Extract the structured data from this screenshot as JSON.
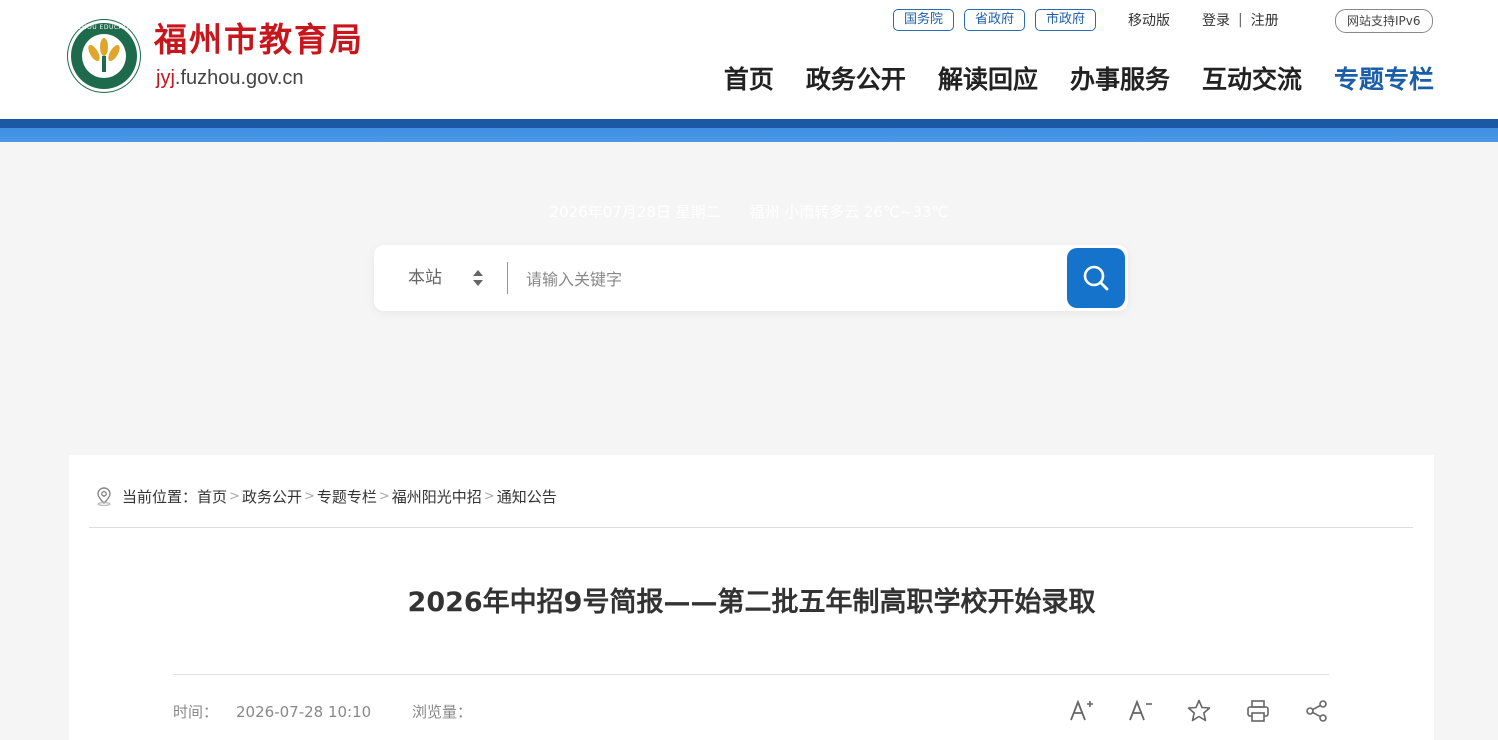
{
  "header": {
    "site_title": "福州市教育局",
    "domain_prefix": "jyj",
    "domain_suffix": ".fuzhou.gov.cn",
    "logo_ring_text": "FUZHOU EDUCATION",
    "top_links": [
      "国务院",
      "省政府",
      "市政府"
    ],
    "mobile": "移动版",
    "login": "登录",
    "register": "注册",
    "link_sep": "|",
    "ipv6": "网站支持IPv6",
    "nav": [
      "首页",
      "政务公开",
      "解读回应",
      "办事服务",
      "互动交流",
      "专题专栏"
    ],
    "active_nav": "专题专栏"
  },
  "info": {
    "date": "2026年07月28日 星期二",
    "weather": "福州 小雨转多云 26℃~33℃"
  },
  "search": {
    "scope": "本站",
    "placeholder": "请输入关键字"
  },
  "breadcrumb": {
    "label": "当前位置：",
    "items": [
      "首页",
      "政务公开",
      "专题专栏",
      "福州阳光中招",
      "通知公告"
    ],
    "sep": ">"
  },
  "article": {
    "title": "2026年中招9号简报——第二批五年制高职学校开始录取",
    "time_label": "时间：",
    "time": "2026-07-28 10:10",
    "views_label": "浏览量："
  },
  "colors": {
    "brand_red": "#c8161d",
    "brand_blue": "#1b5ea8",
    "search_button": "#1673cb"
  }
}
